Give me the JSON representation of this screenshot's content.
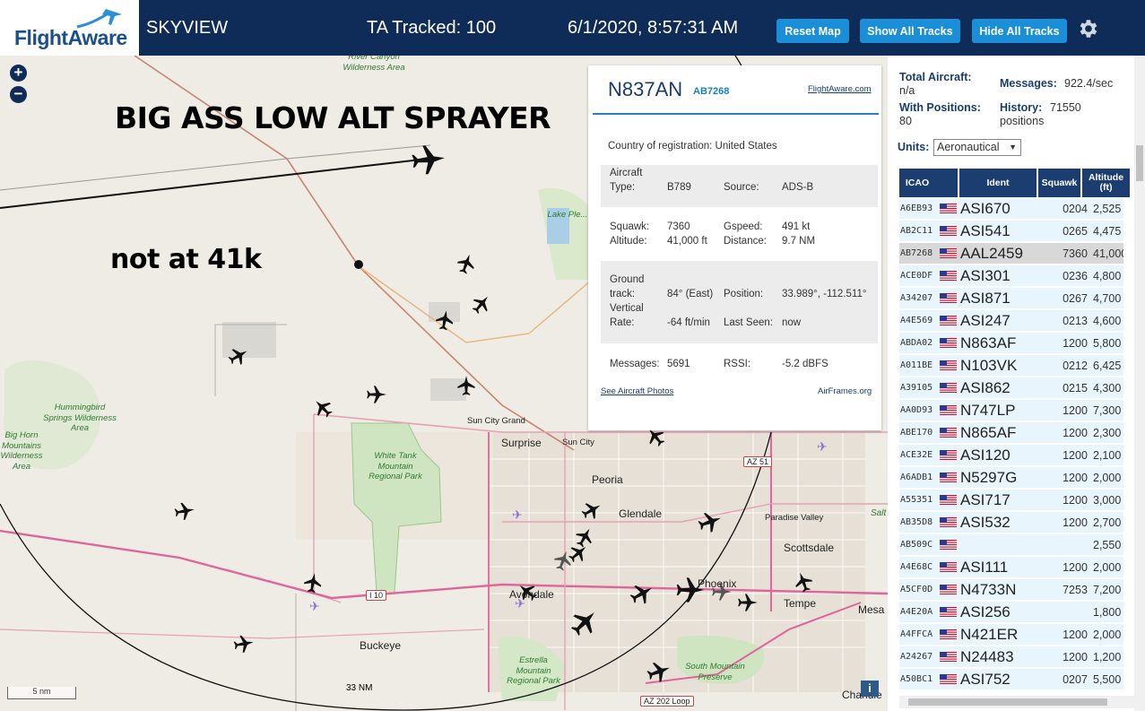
{
  "header": {
    "logo_text": "FlightAware",
    "app_title": "SKYVIEW",
    "ta_tracked": "TA Tracked: 100",
    "datetime": "6/1/2020, 8:57:31 AM",
    "buttons": {
      "reset": "Reset Map",
      "show_all": "Show All Tracks",
      "hide_all": "Hide All Tracks"
    },
    "settings_icon": "gear-icon"
  },
  "map": {
    "annotations": [
      "BIG ASS LOW ALT SPRAYER",
      "not at 41k"
    ],
    "zoom_in": "+",
    "zoom_out": "−",
    "scale_label": "5 nm",
    "ring_label": "33 NM",
    "info_label": "i",
    "places": {
      "sun_city_grand": "Sun City Grand",
      "surprise": "Surprise",
      "sun_city": "Sun City",
      "peoria": "Peoria",
      "glendale": "Glendale",
      "scottsdale": "Scottsdale",
      "paradise_valley": "Paradise Valley",
      "tempe": "Tempe",
      "mesa": "Mesa",
      "avondale": "Avondale",
      "buckeye": "Buckeye",
      "phoenix": "Phoenix",
      "chandler": "Chandle",
      "salt": "Salt"
    },
    "parks": {
      "hummingbird": "Hummingbird Springs Wilderness Area",
      "big_horn": "Big Horn Mountains Wilderness Area",
      "white_tank": "White Tank Mountain Regional Park",
      "estrella": "Estrella Mountain Regional Park",
      "south_mountain": "South Mountain Preserve",
      "river_canyon": "River Canyon Wilderness Area",
      "lake_pleasant": "Lake Ple..."
    },
    "roads": {
      "i10": "I 10",
      "az51": "AZ 51",
      "az202": "AZ 202 Loop"
    }
  },
  "popup": {
    "ident": "N837AN",
    "hex": "AB7268",
    "fa_link": "FlightAware.com",
    "country_label": "Country of registration:",
    "country_value": "United States",
    "aircraft_type_label": "Aircraft Type:",
    "aircraft_type_value": "B789",
    "source_label": "Source:",
    "source_value": "ADS-B",
    "squawk_label": "Squawk:",
    "squawk_value": "7360",
    "gspeed_label": "Gspeed:",
    "gspeed_value": "491 kt",
    "altitude_label": "Altitude:",
    "altitude_value": "41,000 ft",
    "distance_label": "Distance:",
    "distance_value": "9.7 NM",
    "ground_track_label": "Ground track:",
    "ground_track_value": "84° (East)",
    "position_label": "Position:",
    "position_value": "33.989°, -112.511°",
    "vertical_rate_label": "Vertical Rate:",
    "vertical_rate_value": "-64 ft/min",
    "last_seen_label": "Last Seen:",
    "last_seen_value": "now",
    "messages_label": "Messages:",
    "messages_value": "5691",
    "rssi_label": "RSSI:",
    "rssi_value": "-5.2 dBFS",
    "photos_link": "See Aircraft Photos",
    "airframes_link": "AirFrames.org"
  },
  "panel": {
    "total_aircraft_label": "Total Aircraft:",
    "total_aircraft_value": "n/a",
    "messages_label": "Messages:",
    "messages_value": "922.4/sec",
    "with_positions_label": "With Positions:",
    "with_positions_value": "80",
    "history_label": "History:",
    "history_value": "71550",
    "history_unit": "positions",
    "units_label": "Units:",
    "units_value": "Aeronautical",
    "columns": [
      "ICAO",
      "Ident",
      "Squawk",
      "Altitude (ft)"
    ],
    "rows": [
      {
        "icao": "A6EB93",
        "ident": "ASI670",
        "squawk": "0204",
        "alt": "2,525",
        "trend": "up"
      },
      {
        "icao": "AB2C11",
        "ident": "ASI541",
        "squawk": "0265",
        "alt": "4,475",
        "trend": "up"
      },
      {
        "icao": "AB7268",
        "ident": "AAL2459",
        "squawk": "7360",
        "alt": "41,000",
        "trend": "",
        "selected": true
      },
      {
        "icao": "ACE0DF",
        "ident": "ASI301",
        "squawk": "0236",
        "alt": "4,800",
        "trend": "down"
      },
      {
        "icao": "A34207",
        "ident": "ASI871",
        "squawk": "0267",
        "alt": "4,700",
        "trend": "down"
      },
      {
        "icao": "A4E569",
        "ident": "ASI247",
        "squawk": "0213",
        "alt": "4,600",
        "trend": "down"
      },
      {
        "icao": "ABDA02",
        "ident": "N863AF",
        "squawk": "1200",
        "alt": "5,800",
        "trend": "up"
      },
      {
        "icao": "A011BE",
        "ident": "N103VK",
        "squawk": "0212",
        "alt": "6,425",
        "trend": "down"
      },
      {
        "icao": "A39105",
        "ident": "ASI862",
        "squawk": "0215",
        "alt": "4,300",
        "trend": "up"
      },
      {
        "icao": "AA0D93",
        "ident": "N747LP",
        "squawk": "1200",
        "alt": "7,300",
        "trend": "up"
      },
      {
        "icao": "ABE170",
        "ident": "N865AF",
        "squawk": "1200",
        "alt": "2,300",
        "trend": "up"
      },
      {
        "icao": "ACE32E",
        "ident": "ASI120",
        "squawk": "1200",
        "alt": "2,100",
        "trend": "down"
      },
      {
        "icao": "A6ADB1",
        "ident": "N5297G",
        "squawk": "1200",
        "alt": "2,000",
        "trend": "down"
      },
      {
        "icao": "A55351",
        "ident": "ASI717",
        "squawk": "1200",
        "alt": "3,000",
        "trend": "down"
      },
      {
        "icao": "AB35D8",
        "ident": "ASI532",
        "squawk": "1200",
        "alt": "2,700",
        "trend": "down"
      },
      {
        "icao": "AB509C",
        "ident": "",
        "squawk": "",
        "alt": "2,550",
        "trend": "up"
      },
      {
        "icao": "A4E68C",
        "ident": "ASI111",
        "squawk": "1200",
        "alt": "2,000",
        "trend": "down"
      },
      {
        "icao": "A5CF0D",
        "ident": "N4733N",
        "squawk": "7253",
        "alt": "7,200",
        "trend": ""
      },
      {
        "icao": "A4E20A",
        "ident": "ASI256",
        "squawk": "",
        "alt": "1,800",
        "trend": ""
      },
      {
        "icao": "A4FFCA",
        "ident": "N421ER",
        "squawk": "1200",
        "alt": "2,000",
        "trend": ""
      },
      {
        "icao": "A24267",
        "ident": "N24483",
        "squawk": "1200",
        "alt": "1,200",
        "trend": "down"
      },
      {
        "icao": "A50BC1",
        "ident": "ASI752",
        "squawk": "0207",
        "alt": "5,500",
        "trend": ""
      }
    ]
  },
  "colors": {
    "header_bg": "#0e2c57",
    "button_bg": "#1a8fd8",
    "table_header_bg": "#1b3d6f",
    "row_bg": "#e8f5fc",
    "selected_row_bg": "#d8d8d8",
    "popup_rule": "#2b80c2"
  }
}
